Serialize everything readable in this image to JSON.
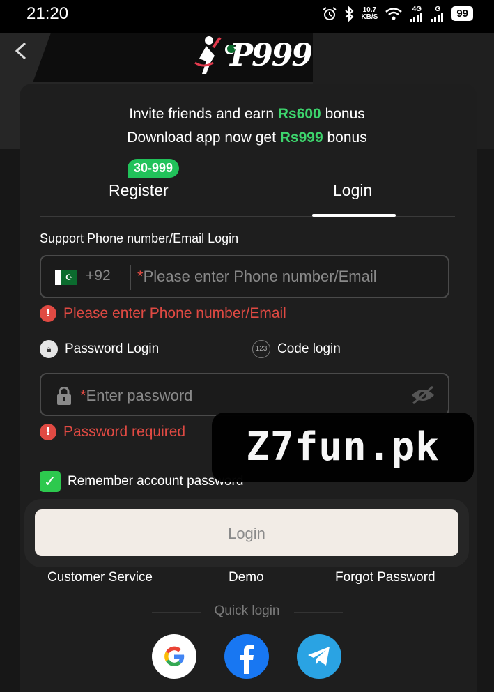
{
  "status_bar": {
    "time": "21:20",
    "speed_value": "10.7",
    "speed_unit": "KB/S",
    "network": "4G",
    "network2": "G",
    "battery": "99"
  },
  "header": {
    "logo_text": "P999"
  },
  "invite": {
    "line1_prefix": "Invite friends and earn ",
    "line1_amount": "Rs600",
    "line1_suffix": " bonus",
    "line2_prefix": "Download app now get ",
    "line2_amount": "Rs999",
    "line2_suffix": " bonus"
  },
  "tabs": {
    "register": "Register",
    "register_badge": "30-999",
    "login": "Login",
    "active": "Login"
  },
  "form": {
    "support_label": "Support Phone number/Email Login",
    "country_code": "+92",
    "phone_required_mark": "*",
    "phone_placeholder": "Please enter Phone number/Email",
    "phone_error": "Please enter Phone number/Email",
    "option_password": "Password Login",
    "option_code": "Code login",
    "option_code_icon": "123",
    "password_required_mark": "*",
    "password_placeholder": "Enter password",
    "password_error": "Password required",
    "remember_label": "Remember account password",
    "remember_checked": true,
    "login_button": "Login"
  },
  "links": {
    "customer_service": "Customer Service",
    "demo": "Demo",
    "forgot_password": "Forgot Password"
  },
  "quick_login": {
    "label": "Quick login",
    "providers": [
      "google",
      "facebook",
      "telegram"
    ]
  },
  "watermark": "Z7fun.pk",
  "colors": {
    "accent_green": "#3dd56d",
    "error_red": "#e04a43",
    "badge_green": "#21c25a",
    "facebook": "#1877f2",
    "telegram": "#2aa3e3"
  },
  "icons": [
    "back-arrow-icon",
    "alarm-icon",
    "bluetooth-icon",
    "wifi-icon",
    "signal-icon",
    "battery-icon",
    "pakistan-flag-icon",
    "error-icon",
    "lock-icon",
    "code-icon",
    "eye-off-icon",
    "checkbox-icon",
    "google-icon",
    "facebook-icon",
    "telegram-icon"
  ]
}
